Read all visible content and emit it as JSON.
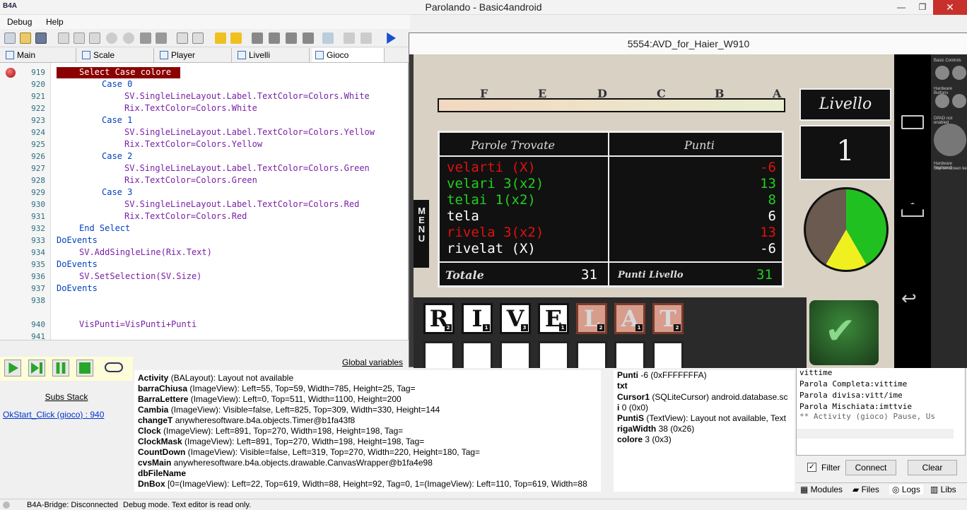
{
  "window": {
    "title": "Parolando - Basic4android",
    "logo": "B4A",
    "minimize": "—",
    "restore": "❐",
    "close": "✕"
  },
  "menu": [
    "Debug",
    "Help"
  ],
  "tabs": [
    "Main",
    "Scale",
    "Player",
    "Livelli",
    "Gioco"
  ],
  "code": {
    "lines": [
      "919",
      "920",
      "921",
      "922",
      "923",
      "924",
      "925",
      "926",
      "927",
      "928",
      "929",
      "930",
      "931",
      "932",
      "933",
      "934",
      "935",
      "936",
      "937",
      "938",
      "940",
      "941"
    ],
    "l919": "Select Case colore",
    "c0": "Case 0",
    "c0a": "SV.SingleLineLayout.Label.TextColor=Colors.White",
    "c0b": "Rix.TextColor=Colors.White",
    "c1": "Case 1",
    "c1a": "SV.SingleLineLayout.Label.TextColor=Colors.Yellow",
    "c1b": "Rix.TextColor=Colors.Yellow",
    "c2": "Case 2",
    "c2a": "SV.SingleLineLayout.Label.TextColor=Colors.Green",
    "c2b": "Rix.TextColor=Colors.Green",
    "c3": "Case 3",
    "c3a": "SV.SingleLineLayout.Label.TextColor=Colors.Red",
    "c3b": "Rix.TextColor=Colors.Red",
    "es": "End Select",
    "de1": "DoEvents",
    "add": "SV.AddSingleLine(Rix.Text)",
    "de2": "DoEvents",
    "sel": "SV.SetSelection(SV.Size)",
    "de3": "DoEvents",
    "vis": "VisPunti=VisPunti+Punti"
  },
  "debug": {
    "subs_stack": "Subs Stack",
    "sub_item": "OkStart_Click (gioco) : 940",
    "globals_link": "Global variables"
  },
  "globals": [
    {
      "n": "Activity",
      "v": "(BALayout): Layout not available"
    },
    {
      "n": "barraChiusa",
      "v": "(ImageView): Left=55, Top=59, Width=785, Height=25, Tag="
    },
    {
      "n": "BarraLettere",
      "v": "(ImageView): Left=0, Top=511, Width=1100, Height=200"
    },
    {
      "n": "Cambia",
      "v": "(ImageView): Visible=false, Left=825, Top=309, Width=330, Height=144"
    },
    {
      "n": "changeT",
      "v": "anywheresoftware.b4a.objects.Timer@b1fa43f8"
    },
    {
      "n": "Clock",
      "v": "(ImageView): Left=891, Top=270, Width=198, Height=198, Tag="
    },
    {
      "n": "ClockMask",
      "v": "(ImageView): Left=891, Top=270, Width=198, Height=198, Tag="
    },
    {
      "n": "CountDown",
      "v": "(ImageView): Visible=false, Left=319, Top=270, Width=220, Height=180, Tag="
    },
    {
      "n": "cvsMain",
      "v": "anywheresoftware.b4a.objects.drawable.CanvasWrapper@b1fa4e98"
    },
    {
      "n": "dbFileName",
      "v": ""
    },
    {
      "n": "DnBox",
      "v": "[0=(ImageView): Left=22, Top=619, Width=88, Height=92, Tag=0, 1=(ImageView): Left=110, Top=619, Width=88"
    }
  ],
  "locals": [
    {
      "n": "Punti",
      "v": "-6 (0xFFFFFFFA)"
    },
    {
      "n": "txt",
      "v": ""
    },
    {
      "n": "Cursor1",
      "v": "(SQLiteCursor) android.database.sc"
    },
    {
      "n": "i",
      "v": "0 (0x0)"
    },
    {
      "n": "PuntiS",
      "v": "(TextView): Layout not available, Text"
    },
    {
      "n": "rigaWidth",
      "v": "38 (0x26)"
    },
    {
      "n": "colore",
      "v": "3 (0x3)"
    }
  ],
  "logs": {
    "lines": [
      "vittime",
      "Parola Completa:vittime",
      "Parola divisa:vitt/ime",
      "Parola Mischiata:imttvie",
      "** Activity (gioco) Pause, Us"
    ],
    "filter": "Filter",
    "connect": "Connect",
    "clear": "Clear"
  },
  "bottom_tabs": [
    "Modules",
    "Files",
    "Logs",
    "Libs"
  ],
  "status": {
    "bridge": "B4A-Bridge: Disconnected",
    "mode": "Debug mode. Text editor is read only."
  },
  "emulator": {
    "title": "5554:AVD_for_Haier_W910",
    "letters": [
      "F",
      "E",
      "D",
      "C",
      "B",
      "A"
    ],
    "table": {
      "h1": "Parole Trovate",
      "h2": "Punti",
      "rows": [
        {
          "w": "velarti (X)",
          "p": "-6",
          "c": "#e01010"
        },
        {
          "w": "velari 3(x2)",
          "p": "13",
          "c": "#20d020"
        },
        {
          "w": "telai 1(x2)",
          "p": "8",
          "c": "#20d020"
        },
        {
          "w": "tela",
          "p": "6",
          "c": "#ffffff"
        },
        {
          "w": "rivela 3(x2)",
          "p": "13",
          "c": "#e01010"
        },
        {
          "w": "rivelat (X)",
          "p": "-6",
          "c": "#ffffff"
        }
      ],
      "totale_lbl": "Totale",
      "totale": "31",
      "livello_lbl": "Punti Livello",
      "livello": "31"
    },
    "livello": "Livello",
    "level": "1",
    "menu": "MENU",
    "tiles": [
      {
        "l": "R",
        "s": "2",
        "used": false
      },
      {
        "l": "I",
        "s": "1",
        "used": false
      },
      {
        "l": "V",
        "s": "3",
        "used": false
      },
      {
        "l": "E",
        "s": "1",
        "used": false
      },
      {
        "l": "L",
        "s": "2",
        "used": true
      },
      {
        "l": "A",
        "s": "1",
        "used": true
      },
      {
        "l": "T",
        "s": "2",
        "used": true
      }
    ],
    "panel": {
      "basic": "Basic Controls",
      "hw": "Hardware Buttons",
      "dpad": "DPAD not enabled",
      "kb": "Hardware Keyboard",
      "kb2": "Use on screen ke"
    }
  }
}
